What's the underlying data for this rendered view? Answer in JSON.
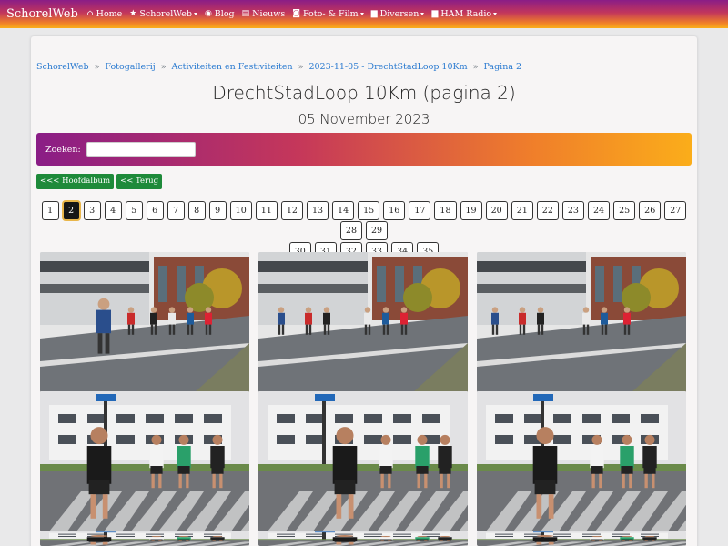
{
  "nav": {
    "brand": "SchorelWeb",
    "items": [
      {
        "label": "Home",
        "icon": "home-icon",
        "glyph": "⌂",
        "dropdown": false
      },
      {
        "label": "SchorelWeb",
        "icon": "star-icon",
        "glyph": "★",
        "dropdown": true
      },
      {
        "label": "Blog",
        "icon": "rss-icon",
        "glyph": "◉",
        "dropdown": false
      },
      {
        "label": "Nieuws",
        "icon": "newspaper-icon",
        "glyph": "▤",
        "dropdown": false
      },
      {
        "label": "Foto- & Film",
        "icon": "camera-icon",
        "glyph": "◙",
        "dropdown": true
      },
      {
        "label": "Diversen",
        "icon": "folder-icon",
        "glyph": "▆",
        "dropdown": true
      },
      {
        "label": "HAM Radio",
        "icon": "folder-icon",
        "glyph": "▆",
        "dropdown": true
      }
    ]
  },
  "breadcrumb": [
    "SchorelWeb",
    "Fotogallerij",
    "Activiteiten en Festiviteiten",
    "2023-11-05 - DrechtStadLoop 10Km",
    "Pagina 2"
  ],
  "breadcrumb_separator": "»",
  "title": "DrechtStadLoop 10Km (pagina 2)",
  "subtitle": "05 November 2023",
  "search": {
    "label": "Zoeken:",
    "value": ""
  },
  "buttons": {
    "main_album": "<<< Hoofdalbum",
    "back": "<< Terug"
  },
  "pagination": {
    "pages": [
      "1",
      "2",
      "3",
      "4",
      "5",
      "6",
      "7",
      "8",
      "9",
      "10",
      "11",
      "12",
      "13",
      "14",
      "15",
      "16",
      "17",
      "18",
      "19",
      "20",
      "21",
      "22",
      "23",
      "24",
      "25",
      "26",
      "27",
      "28",
      "29",
      "30",
      "31",
      "32",
      "33",
      "34",
      "35"
    ],
    "active": "2"
  },
  "photos": [
    {
      "name": "photo-runners-1"
    },
    {
      "name": "photo-runners-2"
    },
    {
      "name": "photo-runners-3"
    },
    {
      "name": "photo-runners-4"
    },
    {
      "name": "photo-runners-5"
    },
    {
      "name": "photo-runners-6"
    },
    {
      "name": "photo-runners-7"
    },
    {
      "name": "photo-runners-8"
    },
    {
      "name": "photo-runners-9"
    }
  ],
  "colors": {
    "accent_link": "#2a7ad0",
    "button_green": "#1e8a3a",
    "gradient_start": "#8a1d86",
    "gradient_end": "#fbad1a"
  }
}
